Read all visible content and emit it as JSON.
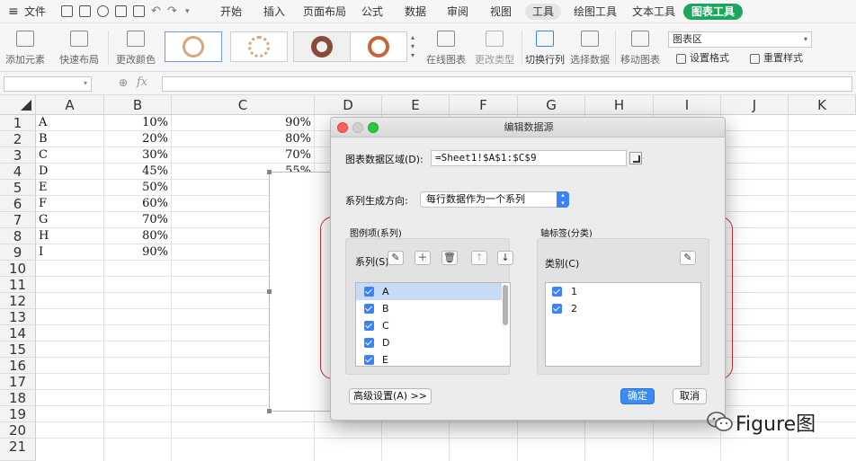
{
  "menubar": {
    "hamburger": "≡",
    "file": "文件",
    "tabs": [
      "开始",
      "插入",
      "页面布局",
      "公式",
      "数据",
      "审阅",
      "视图",
      "工具",
      "绘图工具",
      "文本工具",
      "图表工具"
    ],
    "active_tab": "工具",
    "chart_tab": "图表工具"
  },
  "ribbon": {
    "add_element": "添加元素",
    "quick_layout": "快速布局",
    "change_color": "更改颜色",
    "online_chart": "在线图表",
    "change_type": "更改类型",
    "switch_row_col": "切换行列",
    "select_data": "选择数据",
    "move_chart": "移动图表",
    "chart_area": "图表区",
    "set_format": "设置格式",
    "reset_style": "重置样式"
  },
  "formula": {
    "fx": "fx"
  },
  "columns": [
    "A",
    "B",
    "C",
    "D",
    "E",
    "F",
    "G",
    "H",
    "I",
    "J",
    "K"
  ],
  "rows": [
    "1",
    "2",
    "3",
    "4",
    "5",
    "6",
    "7",
    "8",
    "9",
    "10",
    "11",
    "12",
    "13",
    "14",
    "15",
    "16",
    "17",
    "18",
    "19",
    "20",
    "21"
  ],
  "cells": {
    "col_a": [
      "A",
      "B",
      "C",
      "D",
      "E",
      "F",
      "G",
      "H",
      "I"
    ],
    "col_b": [
      "10%",
      "20%",
      "30%",
      "45%",
      "50%",
      "60%",
      "70%",
      "80%",
      "90%"
    ],
    "col_c": [
      "90%",
      "80%",
      "70%",
      "55%"
    ]
  },
  "dialog": {
    "title": "编辑数据源",
    "range_label": "图表数据区域(D):",
    "range_value": "=Sheet1!$A$1:$C$9",
    "direction_label": "系列生成方向:",
    "direction_value": "每行数据作为一个系列",
    "series_panel_title": "图例项(系列)",
    "series_label": "系列(S)",
    "series_items": [
      "A",
      "B",
      "C",
      "D",
      "E"
    ],
    "axis_panel_title": "轴标签(分类)",
    "category_label": "类别(C)",
    "category_items": [
      "1",
      "2"
    ],
    "advanced_button": "高级设置(A) >>",
    "ok_button": "确定",
    "cancel_button": "取消"
  },
  "watermark": {
    "text": "Figure图"
  },
  "colors": {
    "accent_green": "#1da660",
    "accent_blue": "#3d8bf2",
    "highlight_red": "#c8313a"
  }
}
